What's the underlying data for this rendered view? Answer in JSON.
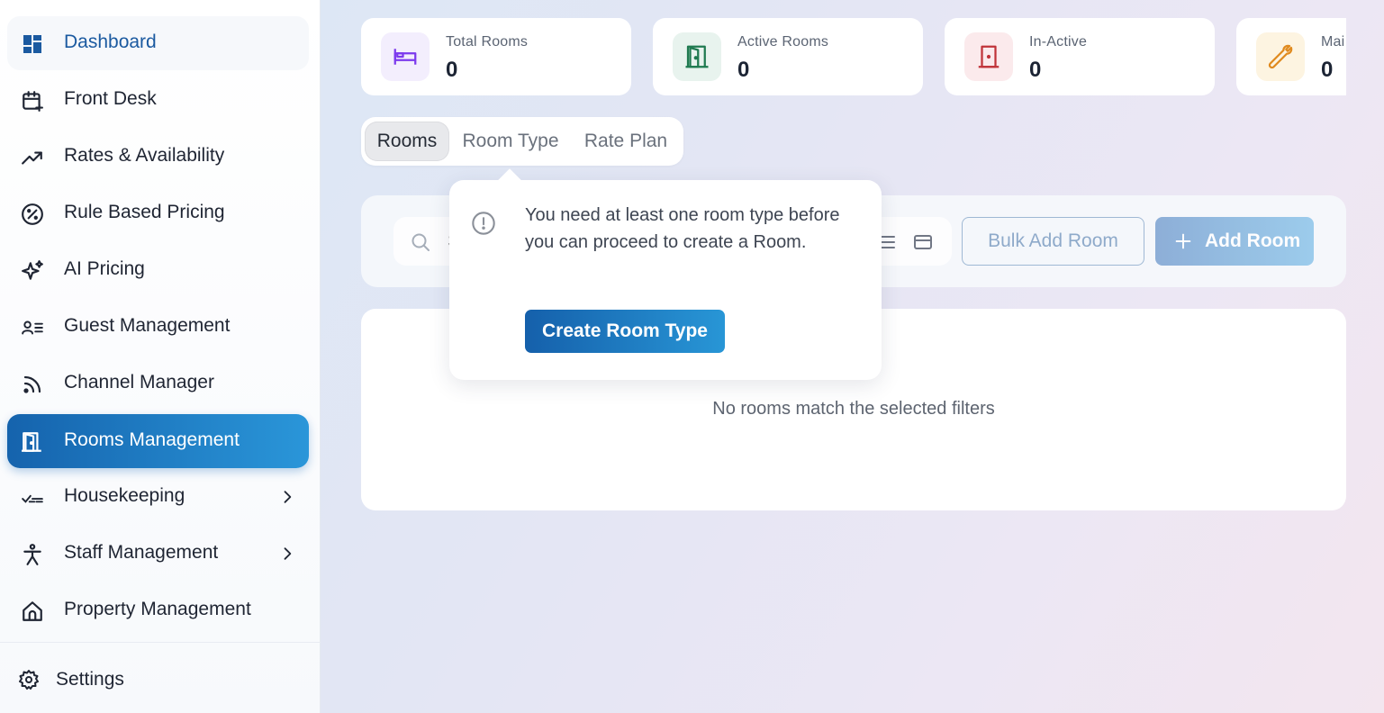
{
  "sidebar": {
    "items": [
      {
        "label": "Dashboard",
        "icon": "dashboard-icon"
      },
      {
        "label": "Front Desk",
        "icon": "calendar-plus-icon"
      },
      {
        "label": "Rates & Availability",
        "icon": "trending-up-icon"
      },
      {
        "label": "Rule Based Pricing",
        "icon": "percent-circle-icon"
      },
      {
        "label": "AI Pricing",
        "icon": "sparkles-icon"
      },
      {
        "label": "Guest Management",
        "icon": "user-list-icon"
      },
      {
        "label": "Channel Manager",
        "icon": "rss-icon"
      },
      {
        "label": "Rooms Management",
        "icon": "door-open-icon"
      },
      {
        "label": "Housekeeping",
        "icon": "checklist-icon"
      },
      {
        "label": "Staff Management",
        "icon": "person-icon"
      },
      {
        "label": "Property Management",
        "icon": "home-icon"
      }
    ],
    "settings_label": "Settings"
  },
  "stats": [
    {
      "title": "Total Rooms",
      "value": "0",
      "icon": "bed-icon",
      "color": "#7c3aed"
    },
    {
      "title": "Active Rooms",
      "value": "0",
      "icon": "door-open-icon",
      "color": "#1f7a50"
    },
    {
      "title": "In-Active",
      "value": "0",
      "icon": "door-closed-icon",
      "color": "#c0343a"
    },
    {
      "title": "Mai",
      "value": "0",
      "icon": "wrench-icon",
      "color": "#e08a1e"
    }
  ],
  "tabs": [
    "Rooms",
    "Room Type",
    "Rate Plan"
  ],
  "toolbar": {
    "search_placeholder": "Search",
    "bulk_add_label": "Bulk Add Room",
    "add_label": "Add Room"
  },
  "empty_message": "No rooms match the selected filters",
  "popover": {
    "message": "You need at least one room type before you can proceed to create a Room.",
    "button_label": "Create Room Type"
  },
  "colors": {
    "primary": "#1a6fb8",
    "active_gradient_end": "#2a96d9"
  }
}
